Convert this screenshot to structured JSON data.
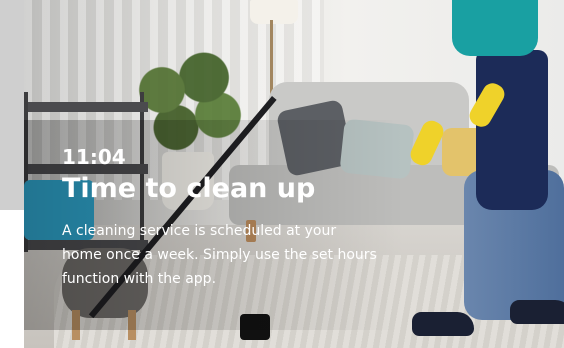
{
  "hero": {
    "time": "11:04",
    "title": "Time to clean up",
    "description": "A cleaning service is scheduled at your home once a week. Simply use the set hours function with the app."
  }
}
